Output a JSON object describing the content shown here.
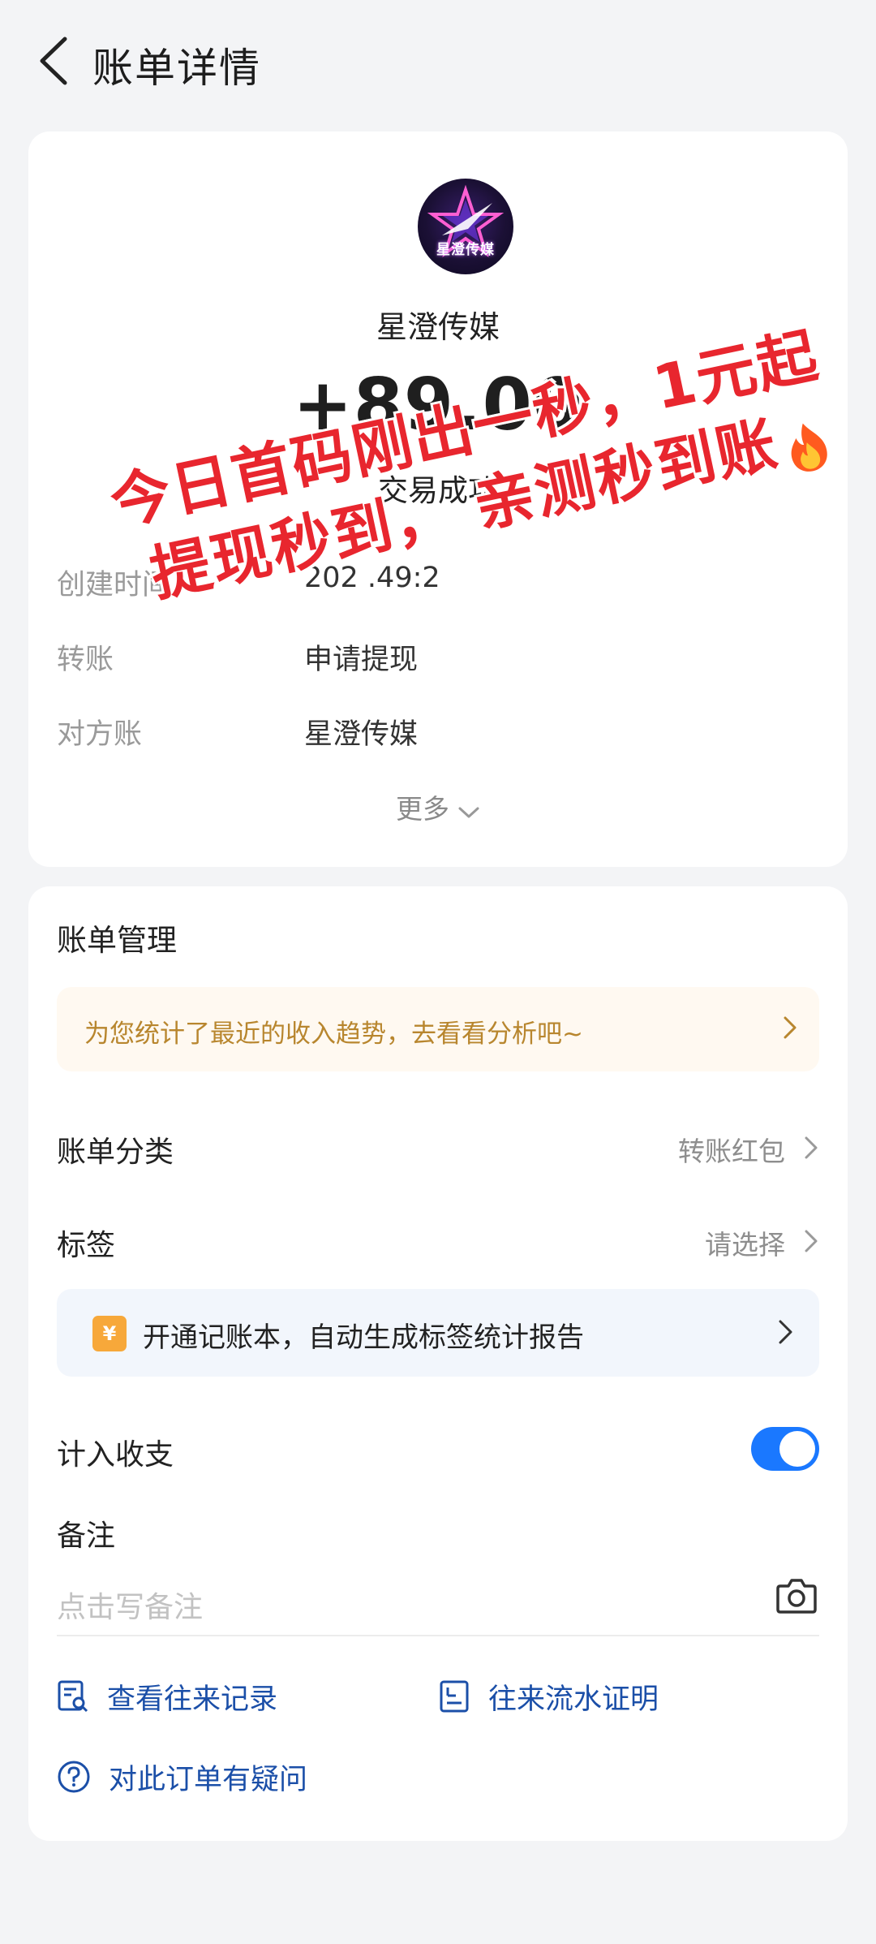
{
  "header": {
    "title": "账单详情"
  },
  "summary": {
    "merchant_name": "星澄传媒",
    "avatar_text": "星澄传媒",
    "amount": "+89.00",
    "status": "交易成功",
    "info_rows": [
      {
        "label": "创建时间",
        "value": "202 .49:2"
      },
      {
        "label": "转账",
        "value": "申请提现"
      },
      {
        "label": "对方账",
        "value": "星澄传媒"
      }
    ],
    "more_label": "更多"
  },
  "overlay": {
    "line1": "今日首码刚出一秒，1元起",
    "line2": "提现秒到， 亲测秒到账"
  },
  "management": {
    "title": "账单管理",
    "trend_banner": "为您统计了最近的收入趋势，去看看分析吧~",
    "category": {
      "label": "账单分类",
      "value": "转账红包"
    },
    "tag": {
      "label": "标签",
      "value": "请选择"
    },
    "ledger_banner": {
      "icon_text": "¥",
      "text": "开通记账本，自动生成标签统计报告"
    },
    "count_in_income": {
      "label": "计入收支",
      "enabled": true
    },
    "note": {
      "label": "备注",
      "placeholder": "点击写备注"
    }
  },
  "actions": {
    "records": "查看往来记录",
    "proof": "往来流水证明",
    "question": "对此订单有疑问"
  },
  "colors": {
    "accent": "#1a78ff",
    "link": "#1b4fa8",
    "overlay_red": "#e8262e",
    "banner_text": "#b8862e"
  }
}
